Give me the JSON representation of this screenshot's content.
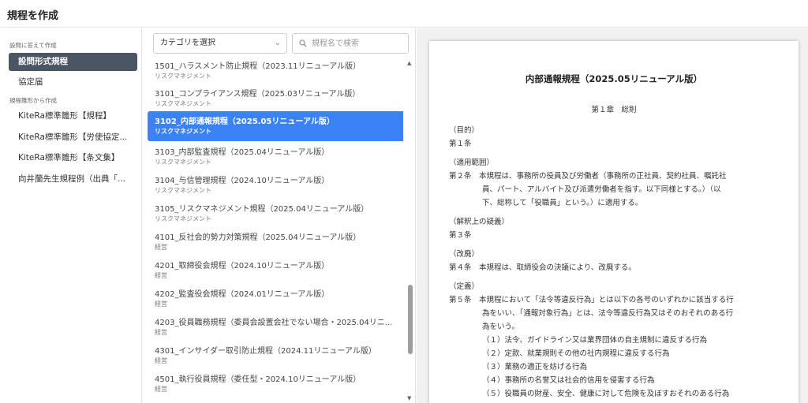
{
  "page_title": "規程を作成",
  "sidebar": {
    "section1": "設問に答えて作成",
    "items1": [
      {
        "label": "設問形式規程",
        "active": true
      },
      {
        "label": "協定届",
        "active": false
      }
    ],
    "section2": "規程雛形から作成",
    "items2": [
      {
        "label": "KiteRa標準雛形【規程】"
      },
      {
        "label": "KiteRa標準雛形【労使協定..."
      },
      {
        "label": "KiteRa標準雛形【条文集】"
      },
      {
        "label": "向井蘭先生規程例（出典「..."
      }
    ]
  },
  "list_pane": {
    "category_select": "カテゴリを選択",
    "search_placeholder": "規程名で検索",
    "rows": [
      {
        "title": "1501_ハラスメント防止規程（2023.11リニューアル版）",
        "category": "リスクマネジメント",
        "selected": false
      },
      {
        "title": "3101_コンプライアンス規程（2025.03リニューアル版）",
        "category": "リスクマネジメント",
        "selected": false
      },
      {
        "title": "3102_内部通報規程（2025.05リニューアル版）",
        "category": "リスクマネジメント",
        "selected": true
      },
      {
        "title": "3103_内部監査規程（2025.04リニューアル版）",
        "category": "リスクマネジメント",
        "selected": false
      },
      {
        "title": "3104_与信管理規程（2024.10リニューアル版）",
        "category": "リスクマネジメント",
        "selected": false
      },
      {
        "title": "3105_リスクマネジメント規程（2025.04リニューアル版）",
        "category": "リスクマネジメント",
        "selected": false
      },
      {
        "title": "4101_反社会的勢力対策規程（2025.04リニューアル版）",
        "category": "経営",
        "selected": false
      },
      {
        "title": "4201_取締役会規程（2024.10リニューアル版）",
        "category": "経営",
        "selected": false
      },
      {
        "title": "4202_監査役会規程（2024.01リニューアル版）",
        "category": "経営",
        "selected": false
      },
      {
        "title": "4203_役員職務規程（委員会設置会社でない場合・2025.04リニ...",
        "category": "経営",
        "selected": false
      },
      {
        "title": "4301_インサイダー取引防止規程（2024.11リニューアル版）",
        "category": "経営",
        "selected": false
      },
      {
        "title": "4501_執行役員規程（委任型・2024.10リニューアル版）",
        "category": "経営",
        "selected": false
      }
    ]
  },
  "document": {
    "title": "内部通報規程（2025.05リニューアル版）",
    "chapter": "第１章　総則",
    "lines": [
      "（目的）",
      "第１条",
      "（適用範囲）",
      "第２条　本規程は、事務所の役員及び労働者（事務所の正社員、契約社員、嘱託社",
      "員、パート、アルバイト及び派遣労働者を指す。以下同様とする。）（以",
      "下、総称して「役職員」という。）に適用する。",
      "（解釈上の疑義）",
      "第３条",
      "（改廃）",
      "第４条　本規程は、取締役会の決議により、改廃する。",
      "（定義）",
      "第５条　本規程において「法令等違反行為」とは以下の各号のいずれかに該当する行",
      "為をいい、「通報対象行為」とは、法令等違反行為又はそのおそれのある行",
      "為をいう。",
      "（１）法令、ガイドライン又は業界団体の自主規制に違反する行為",
      "（２）定款、就業規則その他の社内規程に違反する行為",
      "（３）業務の適正を妨げる行為",
      "（４）事務所の名誉又は社会的信用を侵害する行為",
      "（５）役職員の財産、安全、健康に対して危険を及ぼすおそれのある行為"
    ]
  },
  "icons": {
    "chevron": "chevron-down-icon",
    "search": "search-icon",
    "scroll_up": "scroll-up-icon",
    "scroll_down": "scroll-down-icon"
  },
  "colors": {
    "accent": "#3b82f6",
    "sidebar_active": "#4b5563"
  }
}
